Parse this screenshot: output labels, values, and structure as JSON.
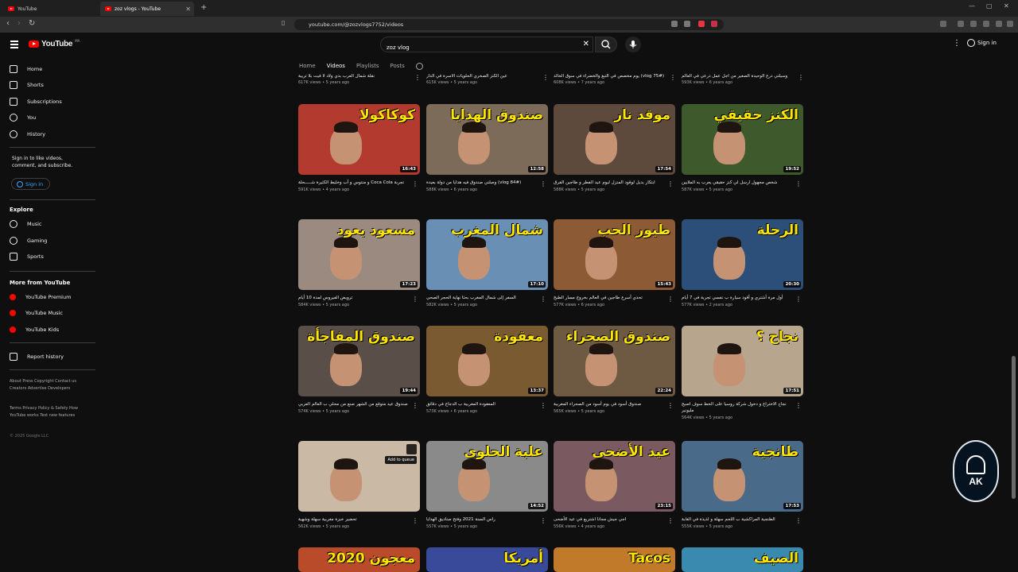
{
  "browser": {
    "tabs": [
      {
        "title": "YouTube"
      },
      {
        "title": "zoz vlogs - YouTube"
      }
    ],
    "url": "youtube.com/@zozvlogs7752/videos"
  },
  "masthead": {
    "logo_text": "YouTube",
    "logo_country": "MA",
    "search_value": "zoz vlog",
    "signin_label": "Sign in"
  },
  "sidebar": {
    "main": [
      {
        "label": "Home",
        "icon": "home-icon"
      },
      {
        "label": "Shorts",
        "icon": "shorts-icon"
      },
      {
        "label": "Subscriptions",
        "icon": "subscriptions-icon"
      },
      {
        "label": "You",
        "icon": "you-icon"
      },
      {
        "label": "History",
        "icon": "history-icon"
      }
    ],
    "signin_prompt": "Sign in to like videos, comment, and subscribe.",
    "signin_button": "Sign in",
    "explore_heading": "Explore",
    "explore": [
      {
        "label": "Music",
        "icon": "music-icon"
      },
      {
        "label": "Gaming",
        "icon": "gaming-icon"
      },
      {
        "label": "Sports",
        "icon": "sports-icon"
      }
    ],
    "more_heading": "More from YouTube",
    "more": [
      {
        "label": "YouTube Premium"
      },
      {
        "label": "YouTube Music"
      },
      {
        "label": "YouTube Kids"
      }
    ],
    "report_history": "Report history",
    "footer1": "About  Press  Copyright  Contact us  Creators  Advertise  Developers",
    "footer2": "Terms  Privacy  Policy & Safety  How YouTube works  Test new features",
    "copyright": "© 2025 Google LLC"
  },
  "channel_tabs": [
    "Home",
    "Videos",
    "Playlists",
    "Posts"
  ],
  "top_row": [
    {
      "title": "نقلة شمال العرب بدي ولاد لا فيت بلا تربية",
      "meta": "617K views • 5 years ago"
    },
    {
      "title": "عين الكنز الصخري الحلويات الاسرة في الدار",
      "meta": "615K views • 5 years ago"
    },
    {
      "title": "(vlog 75#) يوم مخصص في التبغ والخضراء في سوق الخالد",
      "meta": "608K views • 7 years ago"
    },
    {
      "title": "وسيلتي درع الوحيدة الصغير من أجل عمل درعي في العالم",
      "meta": "593K views • 6 years ago"
    }
  ],
  "videos": [
    {
      "thumb_text": "كوكاكولا",
      "bg": "#b23a2f",
      "duration": "16:43",
      "title": "تجربة Coca Cola و منتوس و آب وخليط الكثيرة شـــــحلة",
      "meta": "591K views • 4 years ago"
    },
    {
      "thumb_text": "صندوق الهدايا",
      "bg": "#7d6b5a",
      "duration": "12:58",
      "title": "(vlog 84#) وصلني صندوق فيه هدايا من دولة بعيدة",
      "meta": "588K views • 6 years ago"
    },
    {
      "thumb_text": "موقد نار",
      "bg": "#5e4a3c",
      "duration": "17:54",
      "title": "ابتكار بديل لوقود المنزل ليوم عيد الفطر و طاجين الفرق",
      "meta": "588K views • 5 years ago"
    },
    {
      "thumb_text": "الكنز حقيقي",
      "bg": "#3e5a2c",
      "duration": "19:52",
      "title": "شخص مجهول ارسل لي كنز حقيقي يعرب به الملايين",
      "meta": "587K views • 5 years ago"
    },
    {
      "thumb_text": "مسعود يعود",
      "bg": "#9a8a80",
      "duration": "17:23",
      "title": "ترويض الفيروس لمدة 10 أيام",
      "meta": "584K views • 5 years ago"
    },
    {
      "thumb_text": "شمال المغرب",
      "bg": "#6a8fb5",
      "duration": "17:10",
      "title": "السفر إلى شمال المغرب بحثا نهاية الحجر الصحي",
      "meta": "582K views • 5 years ago"
    },
    {
      "thumb_text": "طيور الحب",
      "bg": "#8c5a34",
      "duration": "15:43",
      "title": "تحدي أسرع طاجين في العالم بخروج مسار الطبخ",
      "meta": "577K views • 6 years ago"
    },
    {
      "thumb_text": "الرحلة",
      "bg": "#2c4f7a",
      "duration": "20:30",
      "title": "أول مرة أشتري و أقود سيارة ب نفسي تجربة في 7 أيام",
      "meta": "577K views • 2 years ago"
    },
    {
      "thumb_text": "صندوق المفاجأة",
      "bg": "#5a4f48",
      "duration": "19:44",
      "title": "صندوق عيد متوقع من الشهر صنع من محلي ب العالم العربي",
      "meta": "574K views • 5 years ago"
    },
    {
      "thumb_text": "معقودة",
      "bg": "#7a5a30",
      "duration": "13:37",
      "title": "المعقودة المغربية ب الدجاج في دقائق",
      "meta": "573K views • 6 years ago"
    },
    {
      "thumb_text": "صندوق الصحراء",
      "bg": "#6e5a42",
      "duration": "22:24",
      "title": "صندوق أسود في يوم أسود من الصحراء المغربية",
      "meta": "565K views • 5 years ago"
    },
    {
      "thumb_text": "نجاح ؟",
      "bg": "#b7a58d",
      "duration": "17:51",
      "title": "نجاح الاختراع و دخول شركة روسيا على الخط سوف اصبح مليونير",
      "meta": "564K views • 5 years ago"
    },
    {
      "thumb_text": "",
      "bg": "#c9b9a5",
      "duration": "",
      "title": "تحضير خبزة مغربية سهلة وشهية",
      "meta": "562K views • 5 years ago",
      "queue": "Add to queue"
    },
    {
      "thumb_text": "علبة الحلوى",
      "bg": "#8a8a8a",
      "duration": "14:52",
      "title": "راس السنة 2021 وفتح صناديق الهدايا",
      "meta": "557K views • 5 years ago"
    },
    {
      "thumb_text": "عيد الأضحى",
      "bg": "#7a5a60",
      "duration": "23:15",
      "title": "اجي جيش مجانا اشتريع في عيد الأضحى",
      "meta": "556K views • 4 years ago"
    },
    {
      "thumb_text": "طانجية",
      "bg": "#4a6a8a",
      "duration": "17:53",
      "title": "الطنجية المراكشية ب اللحم سهلة و لذيذة في الغابة",
      "meta": "555K views • 5 years ago"
    }
  ],
  "bottom_row": [
    {
      "thumb_text": "2020 معجون",
      "bg": "#b94a2a"
    },
    {
      "thumb_text": "أمريكا",
      "bg": "#3a4a9a"
    },
    {
      "thumb_text": "Tacos",
      "bg": "#c07a2a"
    },
    {
      "thumb_text": "الصيف",
      "bg": "#3a8ab0"
    }
  ],
  "watermark_text": "AK"
}
